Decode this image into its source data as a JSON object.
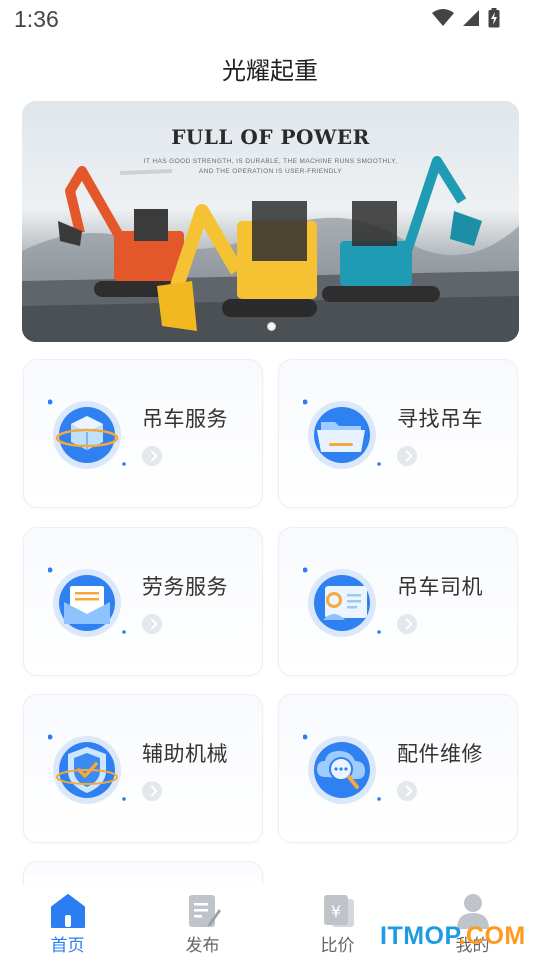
{
  "status_bar": {
    "time": "1:36"
  },
  "header": {
    "title": "光耀起重"
  },
  "banner": {
    "headline": "FULL OF POWER",
    "subline_1": "IT HAS GOOD STRENGTH, IS DURABLE, THE MACHINE RUNS SMOOTHLY,",
    "subline_2": "AND THE OPERATION IS USER-FRIENDLY"
  },
  "services": [
    {
      "label": "吊车服务",
      "icon": "crane-service-cube-icon"
    },
    {
      "label": "寻找吊车",
      "icon": "find-crane-folder-icon"
    },
    {
      "label": "劳务服务",
      "icon": "labor-service-envelope-icon"
    },
    {
      "label": "吊车司机",
      "icon": "crane-driver-id-card-icon"
    },
    {
      "label": "辅助机械",
      "icon": "auxiliary-machinery-shield-icon"
    },
    {
      "label": "配件维修",
      "icon": "parts-repair-chat-cloud-icon"
    }
  ],
  "tab_bar": {
    "items": [
      {
        "label": "首页",
        "icon": "home-icon",
        "active": true
      },
      {
        "label": "发布",
        "icon": "publish-icon",
        "active": false
      },
      {
        "label": "比价",
        "icon": "price-compare-icon",
        "active": false
      },
      {
        "label": "我的",
        "icon": "profile-icon",
        "active": false
      }
    ]
  },
  "watermark": {
    "text": "ITMOP",
    "suffix": ".COM"
  },
  "colors": {
    "accent": "#2b7ef2",
    "tab_inactive": "#666666",
    "watermark": "#1f9be3"
  }
}
